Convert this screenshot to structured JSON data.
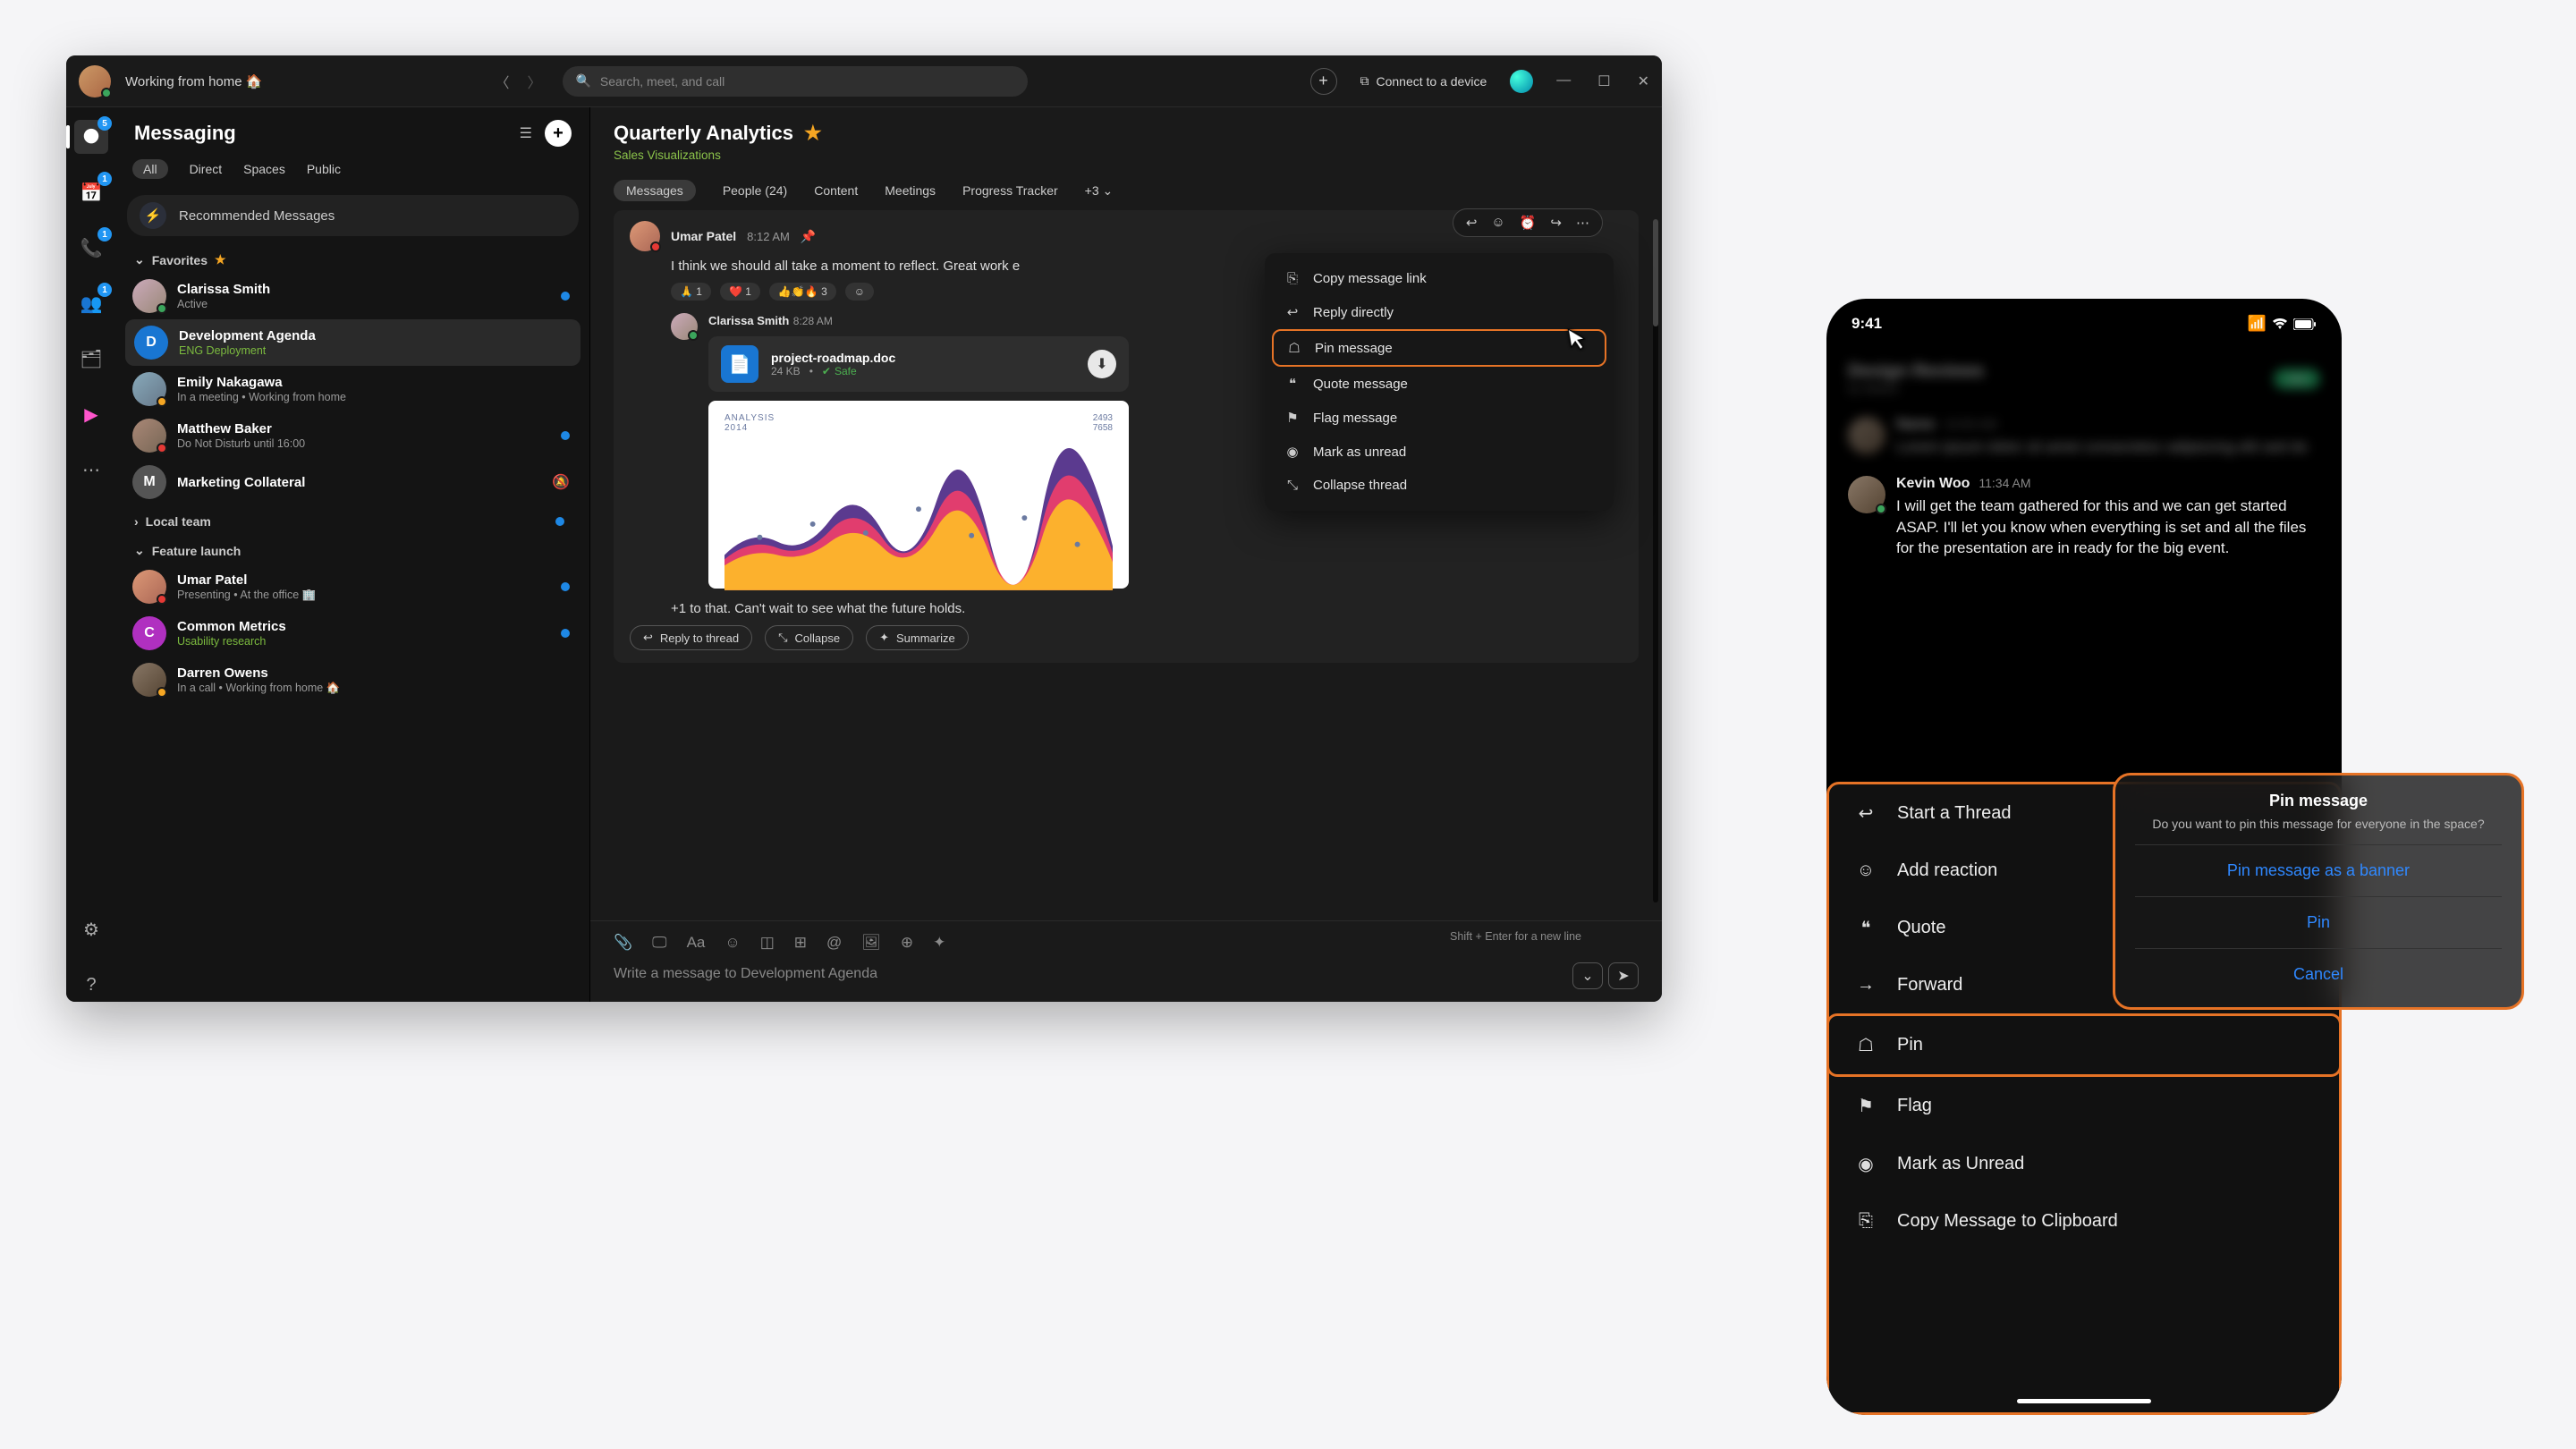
{
  "titlebar": {
    "status": "Working from home 🏠",
    "search_placeholder": "Search, meet, and call",
    "connect": "Connect to a device"
  },
  "rail": {
    "badges": {
      "messaging": "5",
      "cal": "1",
      "call": "1",
      "teams": "1"
    }
  },
  "sidebar": {
    "title": "Messaging",
    "filters": {
      "all": "All",
      "direct": "Direct",
      "spaces": "Spaces",
      "public": "Public"
    },
    "recommended": "Recommended Messages",
    "sections": {
      "fav": "Favorites",
      "local": "Local team",
      "feature": "Feature launch"
    },
    "items": [
      {
        "name": "Clarissa Smith",
        "sub": "Active"
      },
      {
        "name": "Development Agenda",
        "sub": "ENG Deployment",
        "initial": "D"
      },
      {
        "name": "Emily Nakagawa",
        "sub": "In a meeting  •  Working from home"
      },
      {
        "name": "Matthew Baker",
        "sub": "Do Not Disturb until 16:00"
      },
      {
        "name": "Marketing Collateral",
        "sub": "",
        "initial": "M"
      },
      {
        "name": "Umar Patel",
        "sub": "Presenting  •  At the office 🏢"
      },
      {
        "name": "Common Metrics",
        "sub": "Usability research",
        "initial": "C"
      },
      {
        "name": "Darren Owens",
        "sub": "In a call  •  Working from home 🏠"
      }
    ]
  },
  "chat": {
    "title": "Quarterly Analytics",
    "subtitle": "Sales Visualizations",
    "tabs": {
      "messages": "Messages",
      "people": "People (24)",
      "content": "Content",
      "meetings": "Meetings",
      "progress": "Progress Tracker",
      "more": "+3"
    },
    "msg1": {
      "name": "Umar Patel",
      "time": "8:12 AM",
      "text": "I think we should all take a moment to reflect. Great work e"
    },
    "reactions": {
      "r1": "🙏 1",
      "r2": "❤️ 1",
      "r3": "👍👏🔥 3"
    },
    "reply": {
      "name": "Clarissa Smith",
      "time": "8:28 AM"
    },
    "file": {
      "name": "project-roadmap.doc",
      "size": "24 KB",
      "safe": "Safe"
    },
    "chart": {
      "label": "ANALYSIS",
      "year": "2014",
      "v1": "2493",
      "v2": "7658"
    },
    "thread_text": "+1 to that. Can't wait to see what the future holds.",
    "btns": {
      "reply": "Reply to thread",
      "collapse": "Collapse",
      "summarize": "Summarize"
    },
    "ctx": {
      "copy": "Copy message link",
      "reply": "Reply directly",
      "pin": "Pin message",
      "quote": "Quote message",
      "flag": "Flag message",
      "unread": "Mark as unread",
      "collapse": "Collapse thread"
    },
    "compose_hint": "Shift + Enter for a new line",
    "compose_placeholder": "Write a message to Development Agenda"
  },
  "mobile": {
    "time": "9:41",
    "msg": {
      "name": "Kevin Woo",
      "time": "11:34 AM",
      "body": "I will get the team gathered for this and we can get started ASAP. I'll let you know when everything is set and all the files for the presentation are in ready for the big event."
    },
    "sheet": {
      "thread": "Start a Thread",
      "react": "Add reaction",
      "quote": "Quote",
      "forward": "Forward",
      "pin": "Pin",
      "flag": "Flag",
      "unread": "Mark as Unread",
      "copy": "Copy Message to Clipboard"
    },
    "popup": {
      "title": "Pin message",
      "body": "Do you want to pin this message for everyone in the space?",
      "opt1": "Pin message as a banner",
      "opt2": "Pin",
      "opt3": "Cancel"
    }
  }
}
